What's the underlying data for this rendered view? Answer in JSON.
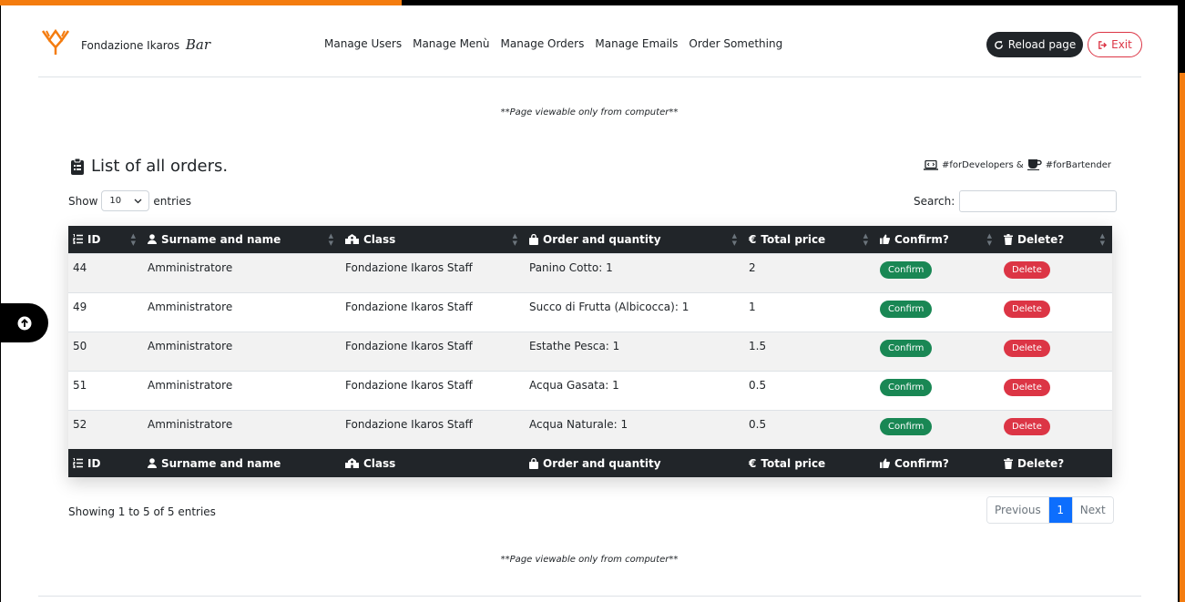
{
  "brand": {
    "name": "Fondazione Ikaros",
    "suffix": "Bar"
  },
  "nav": [
    "Manage Users",
    "Manage Menù",
    "Manage Orders",
    "Manage Emails",
    "Order Something"
  ],
  "actions": {
    "reload": "Reload page",
    "exit": "Exit"
  },
  "notice": "**Page viewable only from computer**",
  "card": {
    "title": "List of all orders.",
    "tag_dev": "#forDevelopers &",
    "tag_bar": "#forBartender"
  },
  "controls": {
    "show": "Show",
    "entries": "entries",
    "page_length": "10",
    "search_label": "Search:",
    "search_value": ""
  },
  "table": {
    "columns": [
      "ID",
      "Surname and name",
      "Class",
      "Order and quantity",
      "Total price",
      "Confirm?",
      "Delete?"
    ],
    "rows": [
      {
        "id": "44",
        "name": "Amministratore",
        "class": "Fondazione Ikaros Staff",
        "order": "Panino Cotto: 1",
        "price": "2",
        "confirm": "Confirm",
        "delete": "Delete"
      },
      {
        "id": "49",
        "name": "Amministratore",
        "class": "Fondazione Ikaros Staff",
        "order": "Succo di Frutta (Albicocca): 1",
        "price": "1",
        "confirm": "Confirm",
        "delete": "Delete"
      },
      {
        "id": "50",
        "name": "Amministratore",
        "class": "Fondazione Ikaros Staff",
        "order": "Estathe Pesca: 1",
        "price": "1.5",
        "confirm": "Confirm",
        "delete": "Delete"
      },
      {
        "id": "51",
        "name": "Amministratore",
        "class": "Fondazione Ikaros Staff",
        "order": "Acqua Gasata: 1",
        "price": "0.5",
        "confirm": "Confirm",
        "delete": "Delete"
      },
      {
        "id": "52",
        "name": "Amministratore",
        "class": "Fondazione Ikaros Staff",
        "order": "Acqua Naturale: 1",
        "price": "0.5",
        "confirm": "Confirm",
        "delete": "Delete"
      }
    ]
  },
  "footer": {
    "info": "Showing 1 to 5 of 5 entries",
    "prev": "Previous",
    "page": "1",
    "next": "Next"
  },
  "colors": {
    "accent": "#f47c0f",
    "dark": "#212529",
    "success": "#198754",
    "danger": "#dc3545",
    "primary": "#0d6efd"
  }
}
